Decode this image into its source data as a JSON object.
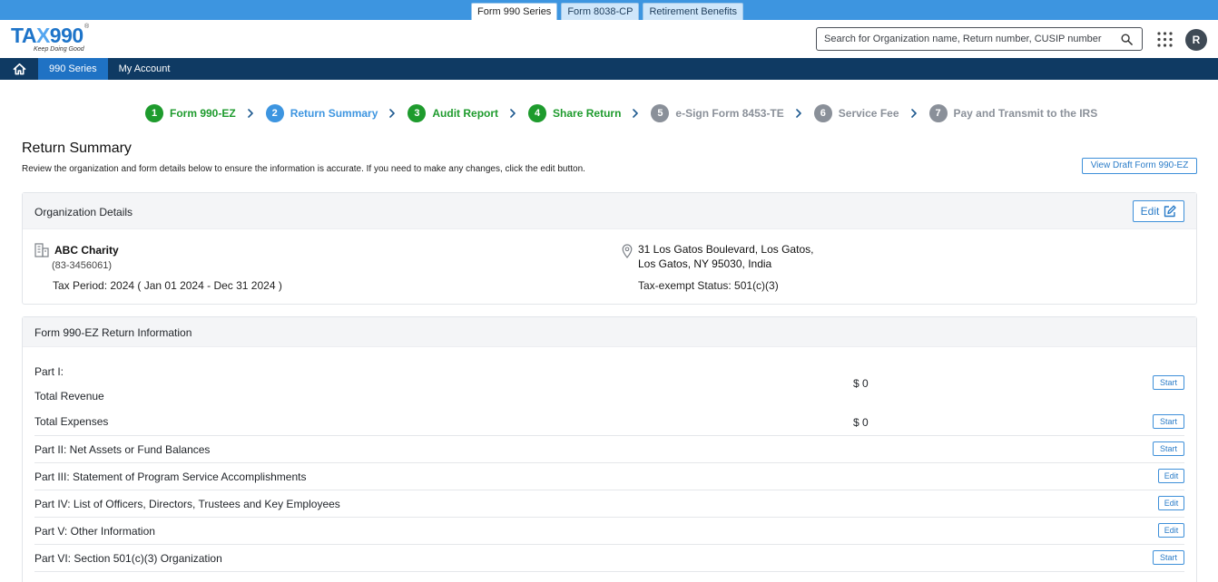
{
  "product_tabs": [
    {
      "label": "Form 990 Series",
      "active": true
    },
    {
      "label": "Form 8038-CP",
      "active": false
    },
    {
      "label": "Retirement Benefits",
      "active": false
    }
  ],
  "logo": {
    "text_a": "TA",
    "text_x": "X",
    "text_b": "990",
    "reg": "®",
    "tagline": "Keep Doing Good"
  },
  "search": {
    "placeholder": "Search for Organization name, Return number, CUSIP number"
  },
  "avatar": {
    "initial": "R"
  },
  "nav": {
    "items": [
      "990 Series",
      "My Account"
    ]
  },
  "steps": [
    {
      "num": "1",
      "label": "Form 990-EZ",
      "state": "done"
    },
    {
      "num": "2",
      "label": "Return Summary",
      "state": "current"
    },
    {
      "num": "3",
      "label": "Audit Report",
      "state": "done"
    },
    {
      "num": "4",
      "label": "Share Return",
      "state": "done"
    },
    {
      "num": "5",
      "label": "e-Sign Form 8453-TE",
      "state": "todo"
    },
    {
      "num": "6",
      "label": "Service Fee",
      "state": "todo"
    },
    {
      "num": "7",
      "label": "Pay and Transmit to the IRS",
      "state": "todo"
    }
  ],
  "page": {
    "title": "Return Summary",
    "description": "Review the organization and form details below to ensure the information is accurate. If you need to make any changes, click the edit button.",
    "view_draft": "View Draft Form 990-EZ"
  },
  "org": {
    "section_title": "Organization Details",
    "edit_label": "Edit",
    "name": "ABC Charity",
    "ein": "(83-3456061)",
    "tax_period": "Tax Period: 2024 ( Jan 01 2024 - Dec 31 2024 )",
    "address_line1": "31 Los Gatos Boulevard, Los Gatos,",
    "address_line2": "Los Gatos, NY 95030, India",
    "exempt_status": "Tax-exempt Status: 501(c)(3)"
  },
  "return_info": {
    "section_title": "Form 990-EZ Return Information",
    "part1_heading": "Part I:",
    "rows": [
      {
        "label": "Total Revenue",
        "amount": "$ 0",
        "button": "Start"
      },
      {
        "label": "Total Expenses",
        "amount": "$ 0",
        "button": "Start"
      },
      {
        "label": "Part II: Net Assets or Fund Balances",
        "button": "Start"
      },
      {
        "label": "Part III: Statement of Program Service Accomplishments",
        "button": "Edit"
      },
      {
        "label": "Part IV: List of Officers, Directors, Trustees and Key Employees",
        "button": "Edit"
      },
      {
        "label": "Part V: Other Information",
        "button": "Edit"
      },
      {
        "label": "Part VI: Section 501(c)(3) Organization",
        "button": "Start"
      }
    ]
  },
  "colors": {
    "brand_blue": "#1e74c9",
    "nav_dark": "#0f3a63",
    "step_done": "#1e9b2d",
    "step_current": "#3d95e0",
    "step_todo": "#8a9099"
  }
}
